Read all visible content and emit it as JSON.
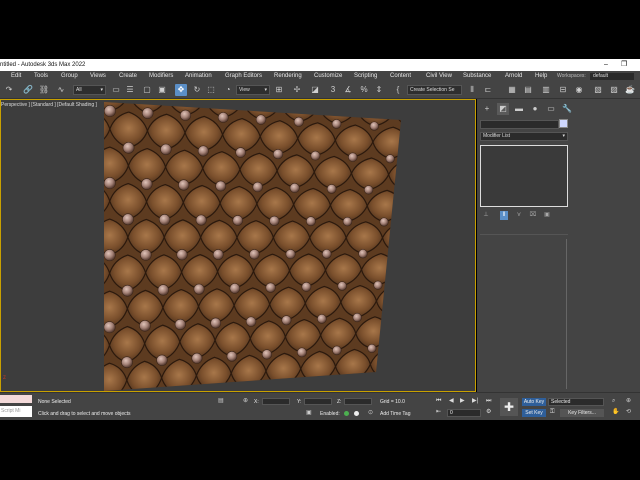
{
  "titlebar": {
    "title": "ntitled - Autodesk 3ds Max 2022",
    "minimize": "–",
    "maximize": "❐",
    "close": "✕"
  },
  "menu": {
    "items": [
      "Edit",
      "Tools",
      "Group",
      "Views",
      "Create",
      "Modifiers",
      "Animation",
      "Graph Editors",
      "Rendering",
      "Customize",
      "Scripting",
      "Content",
      "Civil View",
      "Substance",
      "Arnold",
      "Help"
    ],
    "workspaces_label": "Workspaces:",
    "workspaces_value": "default"
  },
  "toolbar": {
    "filter_value": "All",
    "refcoord_value": "View",
    "selection_set_value": "Create Selection Se",
    "icons": [
      "undo-icon",
      "redo-icon",
      "link-icon",
      "unlink-icon",
      "bind-spacewarp-icon",
      "select-object-icon",
      "select-by-name-icon",
      "rect-select-region-icon",
      "window-crossing-icon",
      "select-move-icon",
      "select-rotate-icon",
      "select-scale-icon",
      "use-pivot-icon",
      "select-manipulate-icon",
      "keyboard-shortcut-icon",
      "snaps-toggle-icon",
      "angle-snap-icon",
      "percent-snap-icon",
      "spinner-snap-icon",
      "mirror-icon",
      "align-icon",
      "layer-explorer-icon",
      "scene-explorer-icon",
      "graphite-icon",
      "curve-editor-icon",
      "schematic-view-icon",
      "material-editor-icon",
      "render-setup-icon",
      "rendered-frame-icon",
      "render-icon"
    ]
  },
  "viewport": {
    "label": "[+] [Perspective ] [Standard ] [Default Shading ]",
    "shown_label": "Perspective ] [Standard ] [Default Shading ]",
    "axis_tripod": "z"
  },
  "command_panel": {
    "tabs": [
      "create-icon",
      "modify-icon",
      "hierarchy-icon",
      "motion-icon",
      "display-icon",
      "utilities-icon"
    ],
    "modifier_list": "Modifier List",
    "stack_buttons": [
      "pin-stack-icon",
      "show-end-result-icon",
      "make-unique-icon",
      "remove-modifier-icon",
      "configure-modifier-sets-icon"
    ]
  },
  "statusbar": {
    "maxscript_placeholder": "",
    "maxscript_text": "Script Mi",
    "selection_status": "None Selected",
    "prompt": "Click and drag to select and move objects",
    "x_label": "X:",
    "y_label": "Y:",
    "z_label": "Z:",
    "grid": "Grid = 10.0",
    "enabled_label": "Enabled:",
    "add_time_tag": "Add Time Tag",
    "frame_value": "0",
    "auto_key": "Auto Key",
    "auto_key_selected": "Selected",
    "set_key": "Set Key",
    "key_filters": "Key Filters..."
  },
  "colors": {
    "ui_background": "#444444",
    "viewport_background": "#3d3d3d",
    "active_viewport_border": "#c8a000",
    "leather": "#7a4f2c",
    "button": "#ae8f86",
    "accent_blue": "#5b8fc7"
  }
}
